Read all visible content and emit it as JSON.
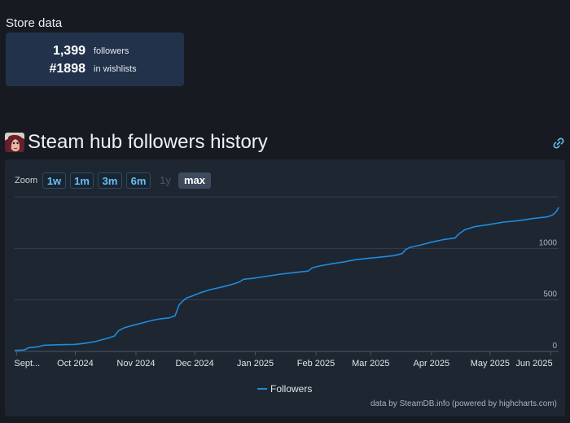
{
  "store": {
    "title": "Store data",
    "stats": [
      {
        "value": "1,399",
        "label": "followers"
      },
      {
        "value": "#1898",
        "label": "in wishlists"
      }
    ]
  },
  "hub": {
    "title": "Steam hub followers history",
    "icon": "game-avatar-icon",
    "link_icon": "link-icon"
  },
  "zoom": {
    "label": "Zoom",
    "buttons": [
      {
        "label": "1w",
        "state": "normal"
      },
      {
        "label": "1m",
        "state": "normal"
      },
      {
        "label": "3m",
        "state": "normal"
      },
      {
        "label": "6m",
        "state": "normal"
      },
      {
        "label": "1y",
        "state": "disabled"
      },
      {
        "label": "max",
        "state": "selected"
      }
    ]
  },
  "footer": {
    "credit": "data by SteamDB.info (powered by highcharts.com)"
  },
  "colors": {
    "background": "#171a21",
    "panel": "#1e2631",
    "card": "#22324a",
    "accent": "#66c0f4",
    "series": "#1f8be0"
  },
  "chart_data": {
    "type": "line",
    "title": "",
    "x_tick_labels": [
      "Sept...",
      "Oct 2024",
      "Nov 2024",
      "Dec 2024",
      "Jan 2025",
      "Feb 2025",
      "Mar 2025",
      "Apr 2025",
      "May 2025",
      "Jun 2025"
    ],
    "x_tick_dates": [
      "2024-09-01",
      "2024-10-01",
      "2024-11-01",
      "2024-12-01",
      "2025-01-01",
      "2025-02-01",
      "2025-03-01",
      "2025-04-01",
      "2025-05-01",
      "2025-06-01"
    ],
    "y_ticks": [
      0,
      500,
      1000
    ],
    "ylim": [
      0,
      1500
    ],
    "xlim": [
      "2024-08-31",
      "2025-06-05"
    ],
    "y_axis_position": "right",
    "grid": true,
    "legend": {
      "position": "bottom-center"
    },
    "series": [
      {
        "name": "Followers",
        "points": [
          [
            "2024-08-31",
            10
          ],
          [
            "2024-09-05",
            14
          ],
          [
            "2024-09-07",
            35
          ],
          [
            "2024-09-12",
            45
          ],
          [
            "2024-09-15",
            60
          ],
          [
            "2024-09-22",
            65
          ],
          [
            "2024-09-30",
            68
          ],
          [
            "2024-10-02",
            70
          ],
          [
            "2024-10-06",
            80
          ],
          [
            "2024-10-11",
            95
          ],
          [
            "2024-10-15",
            115
          ],
          [
            "2024-10-18",
            130
          ],
          [
            "2024-10-21",
            150
          ],
          [
            "2024-10-23",
            200
          ],
          [
            "2024-10-26",
            230
          ],
          [
            "2024-10-31",
            255
          ],
          [
            "2024-11-05",
            280
          ],
          [
            "2024-11-09",
            300
          ],
          [
            "2024-11-13",
            315
          ],
          [
            "2024-11-18",
            325
          ],
          [
            "2024-11-21",
            345
          ],
          [
            "2024-11-23",
            450
          ],
          [
            "2024-11-25",
            490
          ],
          [
            "2024-11-27",
            520
          ],
          [
            "2024-11-30",
            540
          ],
          [
            "2024-12-04",
            570
          ],
          [
            "2024-12-09",
            600
          ],
          [
            "2024-12-15",
            625
          ],
          [
            "2024-12-20",
            650
          ],
          [
            "2024-12-24",
            675
          ],
          [
            "2024-12-26",
            700
          ],
          [
            "2024-12-31",
            710
          ],
          [
            "2025-01-07",
            730
          ],
          [
            "2025-01-14",
            750
          ],
          [
            "2025-01-21",
            765
          ],
          [
            "2025-01-28",
            780
          ],
          [
            "2025-01-30",
            810
          ],
          [
            "2025-02-03",
            830
          ],
          [
            "2025-02-09",
            850
          ],
          [
            "2025-02-15",
            868
          ],
          [
            "2025-02-21",
            890
          ],
          [
            "2025-02-28",
            905
          ],
          [
            "2025-03-06",
            915
          ],
          [
            "2025-03-13",
            930
          ],
          [
            "2025-03-17",
            950
          ],
          [
            "2025-03-19",
            990
          ],
          [
            "2025-03-21",
            1010
          ],
          [
            "2025-03-26",
            1030
          ],
          [
            "2025-04-01",
            1060
          ],
          [
            "2025-04-07",
            1085
          ],
          [
            "2025-04-13",
            1100
          ],
          [
            "2025-04-15",
            1140
          ],
          [
            "2025-04-18",
            1180
          ],
          [
            "2025-04-23",
            1210
          ],
          [
            "2025-04-30",
            1230
          ],
          [
            "2025-05-08",
            1255
          ],
          [
            "2025-05-16",
            1270
          ],
          [
            "2025-05-23",
            1290
          ],
          [
            "2025-05-30",
            1305
          ],
          [
            "2025-06-02",
            1325
          ],
          [
            "2025-06-04",
            1360
          ],
          [
            "2025-06-05",
            1399
          ]
        ]
      }
    ]
  }
}
